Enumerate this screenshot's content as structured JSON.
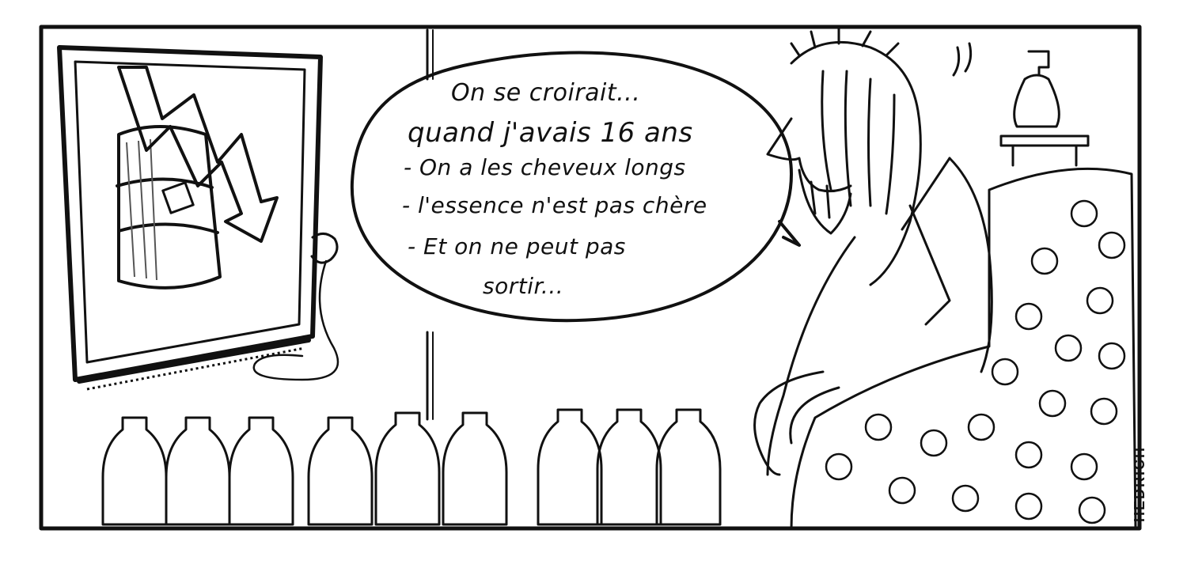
{
  "speech_bubble": {
    "lines": [
      "On se croirait...",
      "quand j'avais 16 ans",
      "- On a les cheveux longs",
      "- l'essence n'est pas chère",
      "- Et on ne peut pas",
      "sortir..."
    ]
  },
  "signature": "HEDRICH",
  "colors": {
    "ink": "#111111",
    "paper": "#ffffff"
  },
  "icons": [
    "tv-screen-icon",
    "oil-barrel-icon",
    "falling-arrow-icon",
    "water-bottle-icon",
    "soap-dispenser-icon",
    "armchair-icon"
  ]
}
